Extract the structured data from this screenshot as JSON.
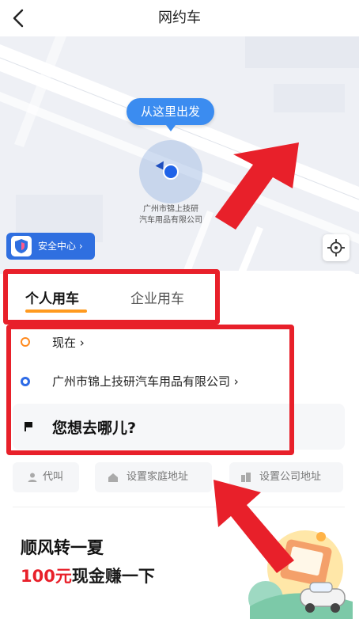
{
  "header": {
    "title": "网约车",
    "back_icon": "chevron-left-icon"
  },
  "map": {
    "pickup_bubble": "从这里出发",
    "poi_label_line1": "广州市锦上技研",
    "poi_label_line2": "汽车用品有限公司",
    "safety_center": "安全中心 ›",
    "locate_icon": "crosshair-icon"
  },
  "tabs": {
    "personal": "个人用车",
    "enterprise": "企业用车",
    "active": "personal"
  },
  "ride": {
    "time": "现在 ›",
    "start": "广州市锦上技研汽车用品有限公司 ›",
    "destination_placeholder": "您想去哪儿?"
  },
  "shortcuts": {
    "proxy": "代叫",
    "home": "设置家庭地址",
    "company": "设置公司地址"
  },
  "promo": {
    "title": "顺风转一夏",
    "amount": "100元",
    "suffix": "现金赚一下"
  },
  "colors": {
    "accent_blue": "#3b8cf0",
    "tab_underline": "#ff9a1f",
    "promo_red": "#e8202a",
    "annotation_red": "#e8202a"
  }
}
